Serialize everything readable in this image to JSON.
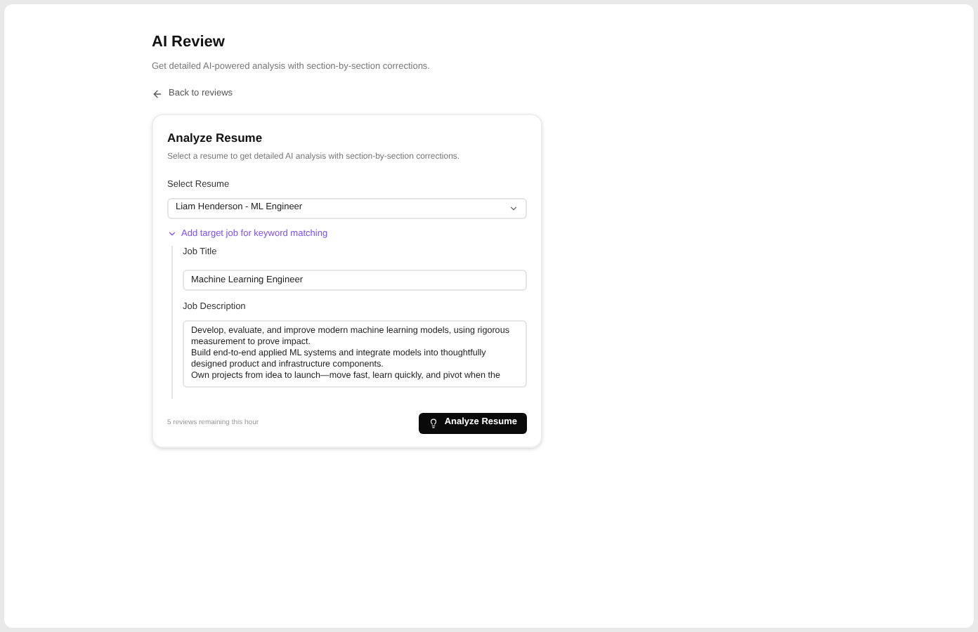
{
  "header": {
    "title": "AI Review",
    "subtitle": "Get detailed AI-powered analysis with section-by-section corrections.",
    "back_link": "Back to reviews"
  },
  "card": {
    "title": "Analyze Resume",
    "subtitle": "Select a resume to get detailed AI analysis with section-by-section corrections.",
    "select": {
      "label": "Select Resume",
      "value": "Liam Henderson - ML Engineer"
    },
    "target_job": {
      "label": "Add target job for keyword matching",
      "expanded": true,
      "job_title": {
        "label": "Job Title",
        "value": "Machine Learning Engineer"
      },
      "job_description": {
        "label": "Job Description",
        "value": "Develop, evaluate, and improve modern machine learning models, using rigorous measurement to prove impact.\nBuild end-to-end applied ML systems and integrate models into thoughtfully designed product and infrastructure components.\nOwn projects from idea to launch—move fast, learn quickly, and pivot when the"
      }
    },
    "remaining": "5 reviews remaining this hour",
    "submit": "Analyze Resume"
  }
}
